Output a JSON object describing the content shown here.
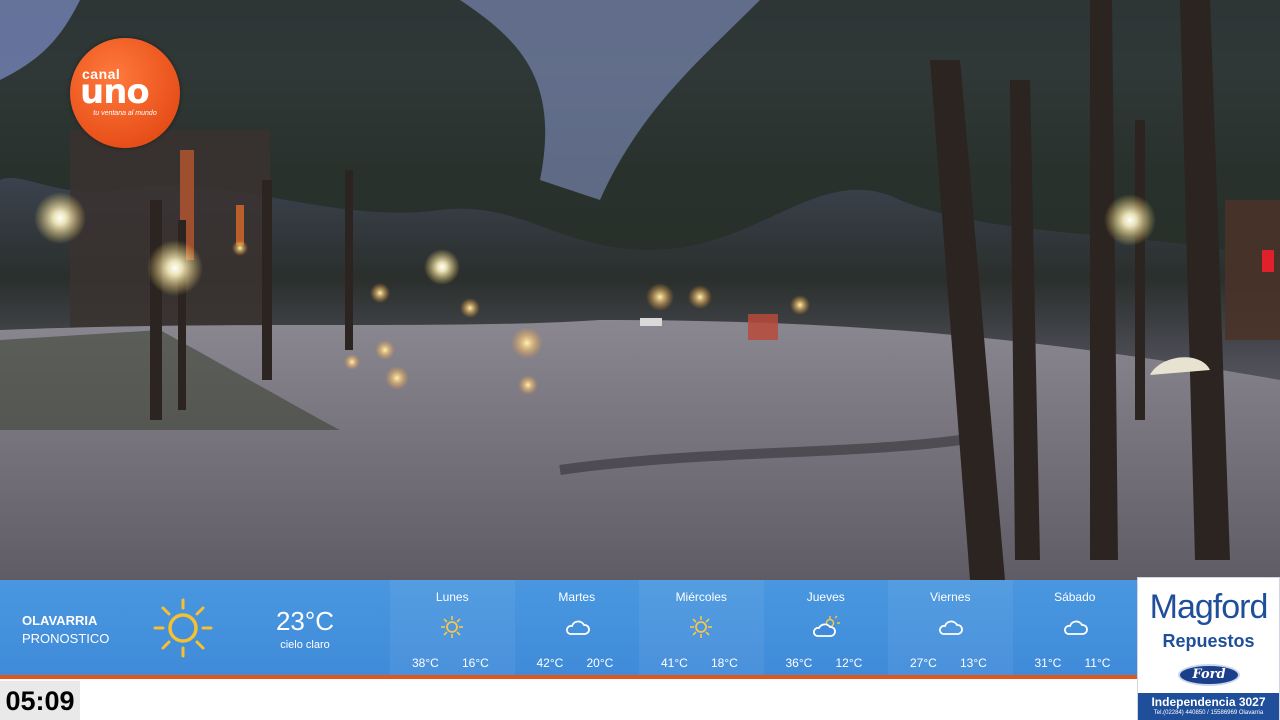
{
  "logo": {
    "line1": "canal",
    "line2": "uno",
    "tagline": "tu ventana al mundo"
  },
  "weather": {
    "city": "OLAVARRIA",
    "subtitle": "PRONOSTICO",
    "current_temp": "23°C",
    "current_condition": "cielo claro",
    "current_icon": "sun-icon",
    "forecast": [
      {
        "day": "Lunes",
        "icon": "sun-icon",
        "max": "38°C",
        "min": "16°C"
      },
      {
        "day": "Martes",
        "icon": "cloud-icon",
        "max": "42°C",
        "min": "20°C"
      },
      {
        "day": "Miércoles",
        "icon": "sun-icon",
        "max": "41°C",
        "min": "18°C"
      },
      {
        "day": "Jueves",
        "icon": "partly-cloudy-icon",
        "max": "36°C",
        "min": "12°C"
      },
      {
        "day": "Viernes",
        "icon": "cloud-icon",
        "max": "27°C",
        "min": "13°C"
      },
      {
        "day": "Sábado",
        "icon": "cloud-icon",
        "max": "31°C",
        "min": "11°C"
      }
    ]
  },
  "ad": {
    "brand": "Magford",
    "tagline": "Repuestos",
    "logo_text": "Ford",
    "address": "Independencia 3027",
    "phone": "Tel.(02284) 440850 / 15586969 Olavarria"
  },
  "clock": "05:09",
  "colors": {
    "weather_bar": "#3f8bd9",
    "accent": "#e2551d",
    "ad_blue": "#1f4f9a"
  }
}
